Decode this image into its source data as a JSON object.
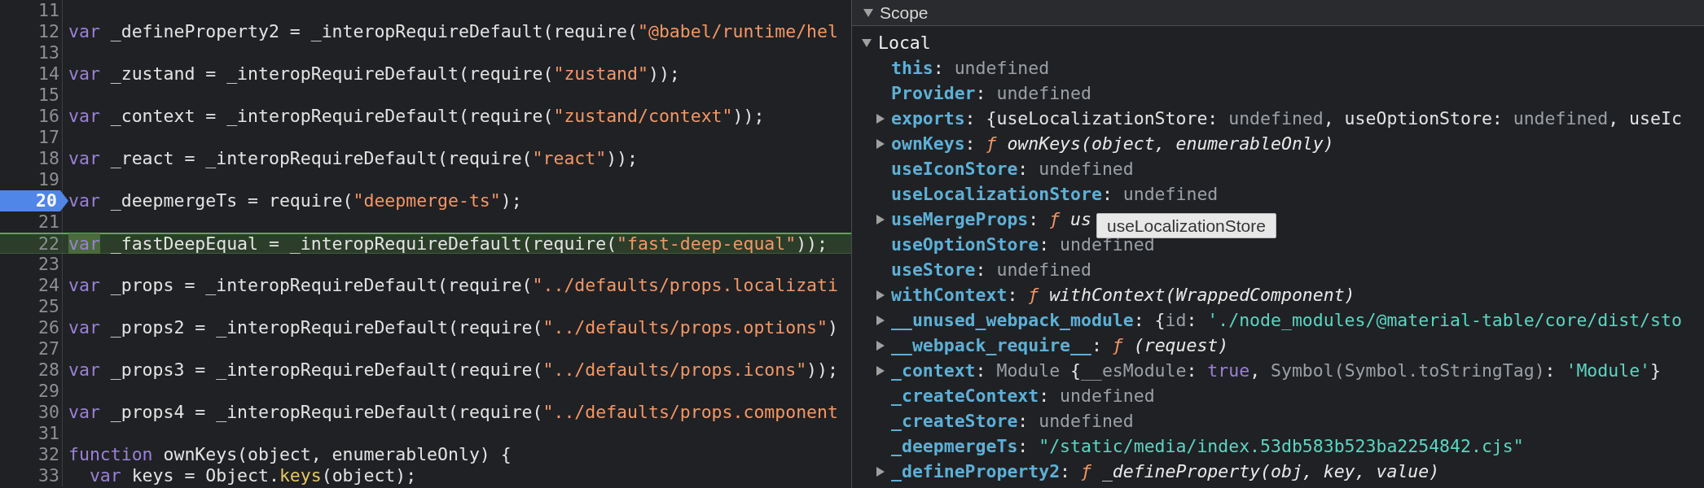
{
  "editor": {
    "lines": [
      {
        "number": "11",
        "breakpoint": false,
        "paused": false
      },
      {
        "number": "12",
        "breakpoint": false,
        "paused": false,
        "segments": [
          {
            "kind": "kw",
            "text": "var"
          },
          {
            "kind": "plain",
            "text": " _defineProperty2 = _interopRequireDefault(require("
          },
          {
            "kind": "str",
            "text": "\"@babel/runtime/hel"
          }
        ]
      },
      {
        "number": "13",
        "breakpoint": false,
        "paused": false
      },
      {
        "number": "14",
        "breakpoint": false,
        "paused": false,
        "segments": [
          {
            "kind": "kw",
            "text": "var"
          },
          {
            "kind": "plain",
            "text": " _zustand = _interopRequireDefault(require("
          },
          {
            "kind": "str",
            "text": "\"zustand\""
          },
          {
            "kind": "plain",
            "text": "));"
          }
        ]
      },
      {
        "number": "15",
        "breakpoint": false,
        "paused": false
      },
      {
        "number": "16",
        "breakpoint": false,
        "paused": false,
        "segments": [
          {
            "kind": "kw",
            "text": "var"
          },
          {
            "kind": "plain",
            "text": " _context = _interopRequireDefault(require("
          },
          {
            "kind": "str",
            "text": "\"zustand/context\""
          },
          {
            "kind": "plain",
            "text": "));"
          }
        ]
      },
      {
        "number": "17",
        "breakpoint": false,
        "paused": false
      },
      {
        "number": "18",
        "breakpoint": false,
        "paused": false,
        "segments": [
          {
            "kind": "kw",
            "text": "var"
          },
          {
            "kind": "plain",
            "text": " _react = _interopRequireDefault(require("
          },
          {
            "kind": "str",
            "text": "\"react\""
          },
          {
            "kind": "plain",
            "text": "));"
          }
        ]
      },
      {
        "number": "19",
        "breakpoint": false,
        "paused": false
      },
      {
        "number": "20",
        "breakpoint": true,
        "paused": false,
        "segments": [
          {
            "kind": "kw",
            "text": "var"
          },
          {
            "kind": "plain",
            "text": " _deepmergeTs = require("
          },
          {
            "kind": "str",
            "text": "\"deepmerge-ts\""
          },
          {
            "kind": "plain",
            "text": ");"
          }
        ]
      },
      {
        "number": "21",
        "breakpoint": false,
        "paused": false
      },
      {
        "number": "22",
        "breakpoint": false,
        "paused": true,
        "segments": [
          {
            "kind": "kwsel",
            "text": "var"
          },
          {
            "kind": "plain",
            "text": " _fastDeepEqual = _interopRequireDefault(require("
          },
          {
            "kind": "str",
            "text": "\"fast-deep-equal\""
          },
          {
            "kind": "plain",
            "text": "));"
          }
        ]
      },
      {
        "number": "23",
        "breakpoint": false,
        "paused": false
      },
      {
        "number": "24",
        "breakpoint": false,
        "paused": false,
        "segments": [
          {
            "kind": "kw",
            "text": "var"
          },
          {
            "kind": "plain",
            "text": " _props = _interopRequireDefault(require("
          },
          {
            "kind": "str",
            "text": "\"../defaults/props.localizati"
          }
        ]
      },
      {
        "number": "25",
        "breakpoint": false,
        "paused": false
      },
      {
        "number": "26",
        "breakpoint": false,
        "paused": false,
        "segments": [
          {
            "kind": "kw",
            "text": "var"
          },
          {
            "kind": "plain",
            "text": " _props2 = _interopRequireDefault(require("
          },
          {
            "kind": "str",
            "text": "\"../defaults/props.options\""
          },
          {
            "kind": "plain",
            "text": ")"
          }
        ]
      },
      {
        "number": "27",
        "breakpoint": false,
        "paused": false
      },
      {
        "number": "28",
        "breakpoint": false,
        "paused": false,
        "segments": [
          {
            "kind": "kw",
            "text": "var"
          },
          {
            "kind": "plain",
            "text": " _props3 = _interopRequireDefault(require("
          },
          {
            "kind": "str",
            "text": "\"../defaults/props.icons\""
          },
          {
            "kind": "plain",
            "text": "));"
          }
        ]
      },
      {
        "number": "29",
        "breakpoint": false,
        "paused": false
      },
      {
        "number": "30",
        "breakpoint": false,
        "paused": false,
        "segments": [
          {
            "kind": "kw",
            "text": "var"
          },
          {
            "kind": "plain",
            "text": " _props4 = _interopRequireDefault(require("
          },
          {
            "kind": "str",
            "text": "\"../defaults/props.component"
          }
        ]
      },
      {
        "number": "31",
        "breakpoint": false,
        "paused": false
      },
      {
        "number": "32",
        "breakpoint": false,
        "paused": false,
        "segments": [
          {
            "kind": "kw",
            "text": "function"
          },
          {
            "kind": "plain",
            "text": " ownKeys(object, enumerableOnly) {"
          }
        ]
      },
      {
        "number": "33",
        "breakpoint": false,
        "paused": false,
        "segments": [
          {
            "kind": "kw",
            "text": "  var"
          },
          {
            "kind": "plain",
            "text": " keys = Object."
          },
          {
            "kind": "method",
            "text": "keys"
          },
          {
            "kind": "plain",
            "text": "(object);"
          }
        ]
      }
    ]
  },
  "scope": {
    "title": "Scope",
    "expanded": true,
    "groups": [
      {
        "name": "Local",
        "expanded": true,
        "items": [
          {
            "name": "this",
            "expandable": false,
            "value": [
              {
                "kind": "plain",
                "text": ": "
              },
              {
                "kind": "gray",
                "text": "undefined"
              }
            ]
          },
          {
            "name": "Provider",
            "expandable": false,
            "value": [
              {
                "kind": "plain",
                "text": ": "
              },
              {
                "kind": "gray",
                "text": "undefined"
              }
            ]
          },
          {
            "name": "exports",
            "expandable": true,
            "value": [
              {
                "kind": "plain",
                "text": ": {useLocalizationStore: "
              },
              {
                "kind": "gray",
                "text": "undefined"
              },
              {
                "kind": "plain",
                "text": ", useOptionStore: "
              },
              {
                "kind": "gray",
                "text": "undefined"
              },
              {
                "kind": "plain",
                "text": ", useIc"
              }
            ]
          },
          {
            "name": "ownKeys",
            "expandable": true,
            "value": [
              {
                "kind": "plain",
                "text": ": "
              },
              {
                "kind": "f",
                "text": "ƒ"
              },
              {
                "kind": "italic",
                "text": " ownKeys(object, enumerableOnly)"
              }
            ]
          },
          {
            "name": "useIconStore",
            "expandable": false,
            "value": [
              {
                "kind": "plain",
                "text": ": "
              },
              {
                "kind": "gray",
                "text": "undefined"
              }
            ]
          },
          {
            "name": "useLocalizationStore",
            "expandable": false,
            "value": [
              {
                "kind": "plain",
                "text": ": "
              },
              {
                "kind": "gray",
                "text": "undefined"
              }
            ]
          },
          {
            "name": "useMergeProps",
            "expandable": true,
            "value": [
              {
                "kind": "plain",
                "text": ": "
              },
              {
                "kind": "f",
                "text": "ƒ"
              },
              {
                "kind": "italic",
                "text": " us"
              }
            ]
          },
          {
            "name": "useOptionStore",
            "expandable": false,
            "value": [
              {
                "kind": "plain",
                "text": ": "
              },
              {
                "kind": "gray",
                "text": "undefined"
              }
            ]
          },
          {
            "name": "useStore",
            "expandable": false,
            "value": [
              {
                "kind": "plain",
                "text": ": "
              },
              {
                "kind": "gray",
                "text": "undefined"
              }
            ]
          },
          {
            "name": "withContext",
            "expandable": true,
            "value": [
              {
                "kind": "plain",
                "text": ": "
              },
              {
                "kind": "f",
                "text": "ƒ"
              },
              {
                "kind": "italic",
                "text": " withContext(WrappedComponent)"
              }
            ]
          },
          {
            "name": "__unused_webpack_module",
            "expandable": true,
            "value": [
              {
                "kind": "plain",
                "text": ": {"
              },
              {
                "kind": "gray",
                "text": "id"
              },
              {
                "kind": "plain",
                "text": ": "
              },
              {
                "kind": "teal",
                "text": "'./node_modules/@material-table/core/dist/sto"
              }
            ]
          },
          {
            "name": "__webpack_require__",
            "expandable": true,
            "value": [
              {
                "kind": "plain",
                "text": ": "
              },
              {
                "kind": "f",
                "text": "ƒ"
              },
              {
                "kind": "italic",
                "text": " (request)"
              }
            ]
          },
          {
            "name": "_context",
            "expandable": true,
            "value": [
              {
                "kind": "plain",
                "text": ": "
              },
              {
                "kind": "gray",
                "text": "Module "
              },
              {
                "kind": "plain",
                "text": "{"
              },
              {
                "kind": "gray",
                "text": "__esModule"
              },
              {
                "kind": "plain",
                "text": ": "
              },
              {
                "kind": "kw",
                "text": "true"
              },
              {
                "kind": "plain",
                "text": ", "
              },
              {
                "kind": "gray",
                "text": "Symbol(Symbol.toStringTag)"
              },
              {
                "kind": "plain",
                "text": ": "
              },
              {
                "kind": "teal",
                "text": "'Module'"
              },
              {
                "kind": "plain",
                "text": "}"
              }
            ]
          },
          {
            "name": "_createContext",
            "expandable": false,
            "value": [
              {
                "kind": "plain",
                "text": ": "
              },
              {
                "kind": "gray",
                "text": "undefined"
              }
            ]
          },
          {
            "name": "_createStore",
            "expandable": false,
            "value": [
              {
                "kind": "plain",
                "text": ": "
              },
              {
                "kind": "gray",
                "text": "undefined"
              }
            ]
          },
          {
            "name": "_deepmergeTs",
            "expandable": false,
            "value": [
              {
                "kind": "plain",
                "text": ": "
              },
              {
                "kind": "teal",
                "text": "\"/static/media/index.53db583b523ba2254842.cjs\""
              }
            ]
          },
          {
            "name": "_defineProperty2",
            "expandable": true,
            "value": [
              {
                "kind": "plain",
                "text": ": "
              },
              {
                "kind": "f",
                "text": "ƒ"
              },
              {
                "kind": "italic",
                "text": " _defineProperty(obj, key, value)"
              }
            ]
          }
        ]
      }
    ]
  },
  "tooltip": {
    "text": "useLocalizationStore"
  }
}
